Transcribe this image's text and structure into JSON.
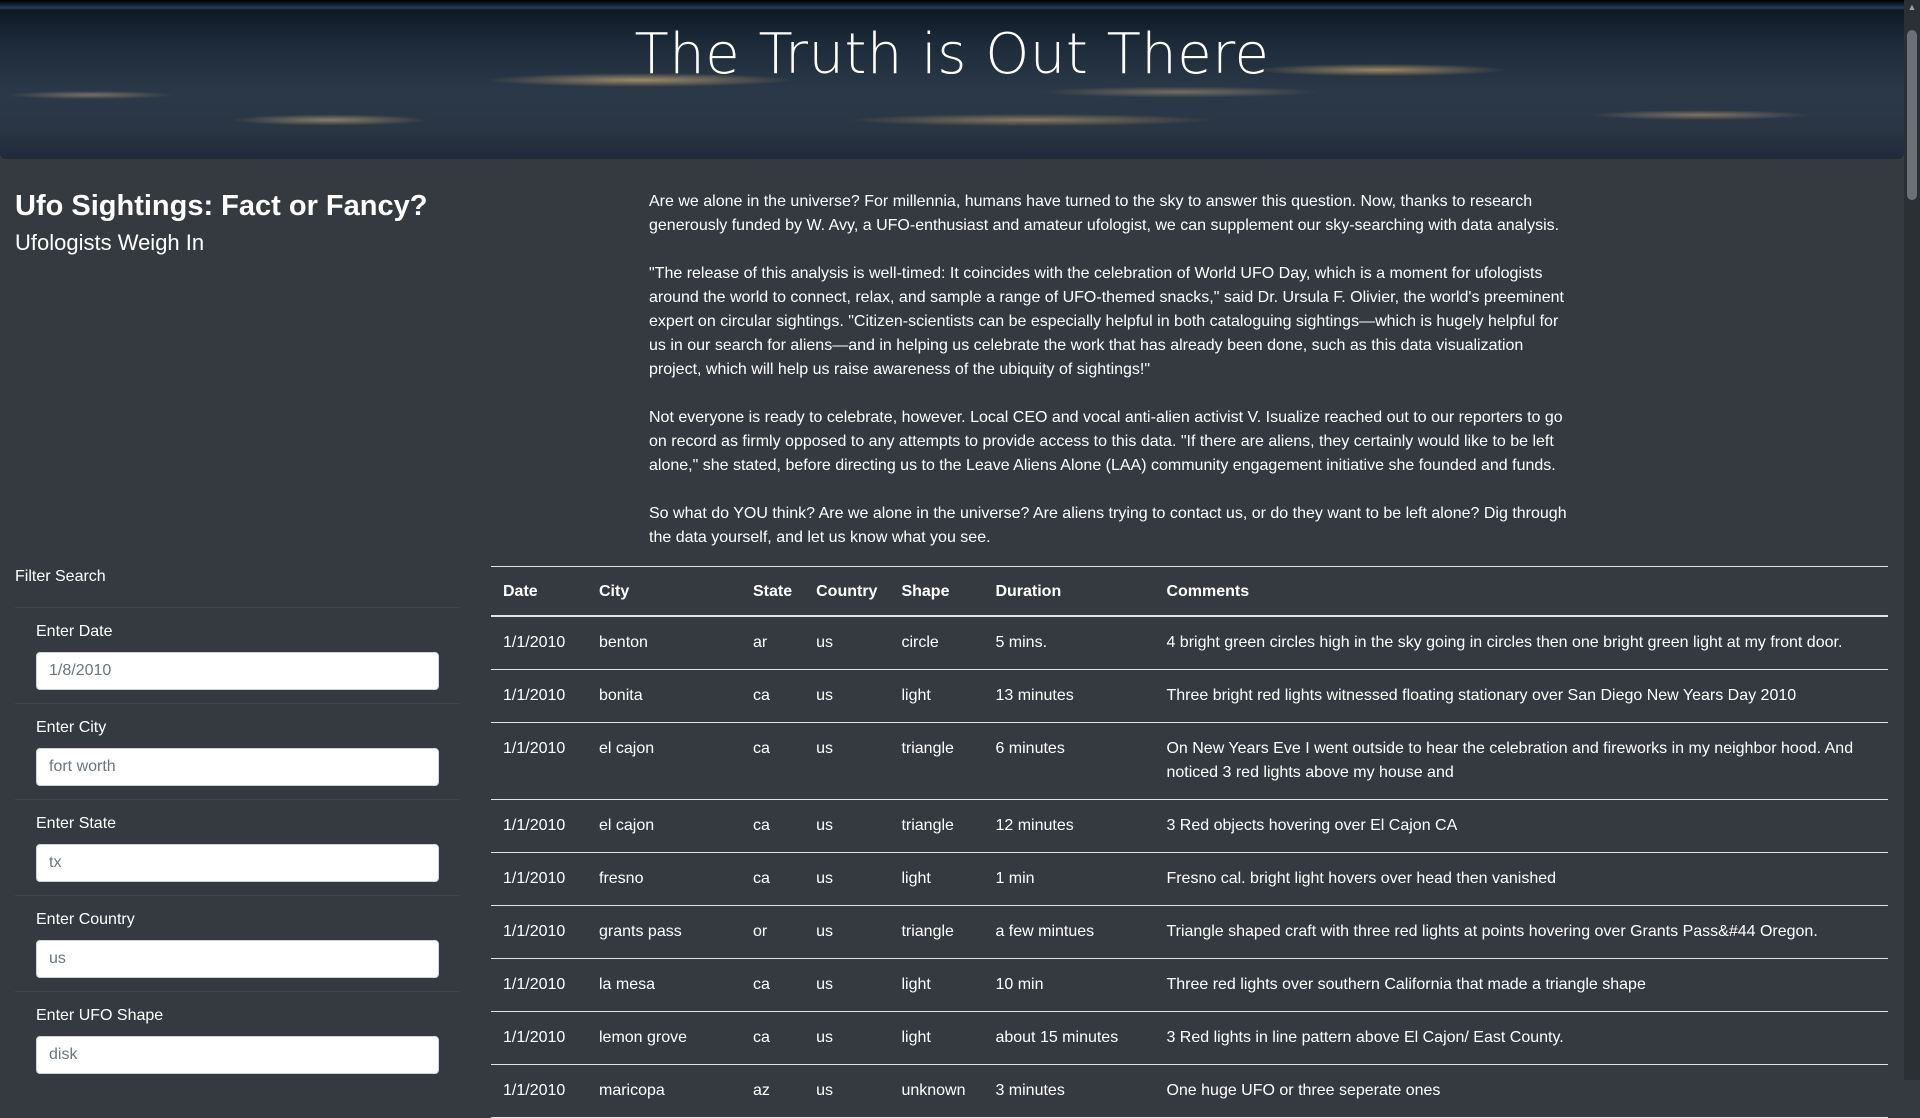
{
  "hero": {
    "title": "The Truth is Out There"
  },
  "sidebar": {
    "title": "Ufo Sightings: Fact or Fancy?",
    "subtitle": "Ufologists Weigh In"
  },
  "article": {
    "paragraphs": [
      "Are we alone in the universe? For millennia, humans have turned to the sky to answer this question. Now, thanks to research generously funded by W. Avy, a UFO-enthusiast and amateur ufologist, we can supplement our sky-searching with data analysis.",
      "\"The release of this analysis is well-timed: It coincides with the celebration of World UFO Day, which is a moment for ufologists around the world to connect, relax, and sample a range of UFO-themed snacks,\" said Dr. Ursula F. Olivier, the world's preeminent expert on circular sightings. \"Citizen-scientists can be especially helpful in both cataloguing sightings—which is hugely helpful for us in our search for aliens—and in helping us celebrate the work that has already been done, such as this data visualization project, which will help us raise awareness of the ubiquity of sightings!\"",
      "Not everyone is ready to celebrate, however. Local CEO and vocal anti-alien activist V. Isualize reached out to our reporters to go on record as firmly opposed to any attempts to provide access to this data. \"If there are aliens, they certainly would like to be left alone,\" she stated, before directing us to the Leave Aliens Alone (LAA) community engagement initiative she founded and funds.",
      "So what do YOU think? Are we alone in the universe? Are aliens trying to contact us, or do they want to be left alone? Dig through the data yourself, and let us know what you see."
    ]
  },
  "filters": {
    "title": "Filter Search",
    "items": [
      {
        "label": "Enter Date",
        "placeholder": "1/8/2010"
      },
      {
        "label": "Enter City",
        "placeholder": "fort worth"
      },
      {
        "label": "Enter State",
        "placeholder": "tx"
      },
      {
        "label": "Enter Country",
        "placeholder": "us"
      },
      {
        "label": "Enter UFO Shape",
        "placeholder": "disk"
      }
    ]
  },
  "table": {
    "headers": [
      "Date",
      "City",
      "State",
      "Country",
      "Shape",
      "Duration",
      "Comments"
    ],
    "rows": [
      [
        "1/1/2010",
        "benton",
        "ar",
        "us",
        "circle",
        "5 mins.",
        "4 bright green circles high in the sky going in circles then one bright green light at my front door."
      ],
      [
        "1/1/2010",
        "bonita",
        "ca",
        "us",
        "light",
        "13 minutes",
        "Three bright red lights witnessed floating stationary over San Diego New Years Day 2010"
      ],
      [
        "1/1/2010",
        "el cajon",
        "ca",
        "us",
        "triangle",
        "6 minutes",
        "On New Years Eve I went outside to hear the celebration and fireworks in my neighbor hood. And noticed 3 red lights above my house and"
      ],
      [
        "1/1/2010",
        "el cajon",
        "ca",
        "us",
        "triangle",
        "12 minutes",
        "3 Red objects hovering over El Cajon CA"
      ],
      [
        "1/1/2010",
        "fresno",
        "ca",
        "us",
        "light",
        "1 min",
        "Fresno cal. bright light hovers over head then vanished"
      ],
      [
        "1/1/2010",
        "grants pass",
        "or",
        "us",
        "triangle",
        "a few mintues",
        "Triangle shaped craft with three red lights at points hovering over Grants Pass&#44 Oregon."
      ],
      [
        "1/1/2010",
        "la mesa",
        "ca",
        "us",
        "light",
        "10 min",
        "Three red lights over southern California that made a triangle shape"
      ],
      [
        "1/1/2010",
        "lemon grove",
        "ca",
        "us",
        "light",
        "about 15 minutes",
        "3 Red lights in line pattern above El Cajon/ East County."
      ],
      [
        "1/1/2010",
        "maricopa",
        "az",
        "us",
        "unknown",
        "3 minutes",
        "One huge UFO or three seperate ones"
      ]
    ]
  }
}
